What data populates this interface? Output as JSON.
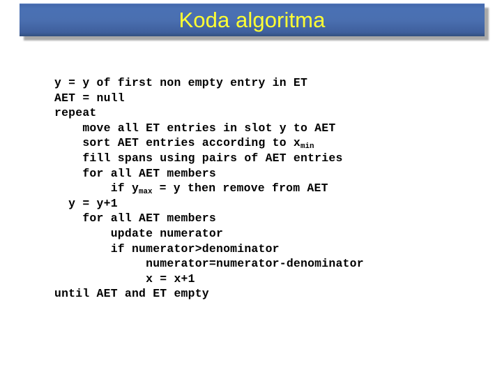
{
  "slide": {
    "background_color": "#ffffff",
    "title_bar": {
      "text": "Koda algoritma",
      "text_color": "#ffff33",
      "fill_color": "#4a6fb0",
      "shadow_color": "#9a9a9a"
    },
    "code": {
      "text_color": "#000000",
      "lines": [
        {
          "indent": 0,
          "text": "y = y of first non empty entry in ET"
        },
        {
          "indent": 0,
          "text": "AET = null"
        },
        {
          "indent": 0,
          "text": "repeat"
        },
        {
          "indent": 4,
          "text": "move all ET entries in slot y to AET"
        },
        {
          "indent": 4,
          "pre": "sort AET entries according to x",
          "sub": "min",
          "post": ""
        },
        {
          "indent": 4,
          "text": "fill spans using pairs of AET entries"
        },
        {
          "indent": 4,
          "text": "for all AET members"
        },
        {
          "indent": 8,
          "pre": "if y",
          "sub": "max",
          "post": " = y then remove from AET"
        },
        {
          "indent": 2,
          "text": "y = y+1"
        },
        {
          "indent": 4,
          "text": "for all AET members"
        },
        {
          "indent": 8,
          "text": "update numerator"
        },
        {
          "indent": 8,
          "text": "if numerator>denominator"
        },
        {
          "indent": 13,
          "text": "numerator=numerator-denominator"
        },
        {
          "indent": 13,
          "text": "x = x+1"
        },
        {
          "indent": 0,
          "text": "until AET and ET empty"
        }
      ]
    }
  }
}
